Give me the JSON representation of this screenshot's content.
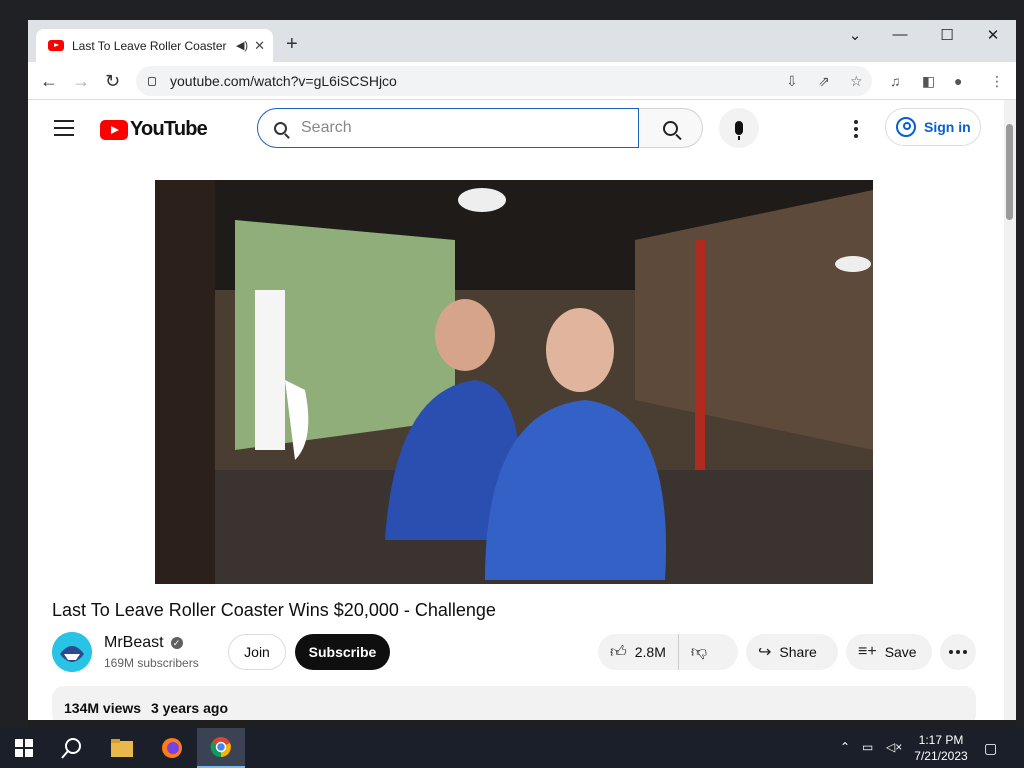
{
  "browser": {
    "tab_title": "Last To Leave Roller Coaster Wins $20,000 - Challenge",
    "tab_short": "Last To Leave Roller Coaster",
    "url": "youtube.com/watch?v=gL6iSCSHjco"
  },
  "youtube": {
    "logo_text": "YouTube",
    "search_placeholder": "Search",
    "signin_label": "Sign in"
  },
  "video": {
    "title": "Last To Leave Roller Coaster Wins $20,000 - Challenge",
    "channel": "MrBeast",
    "subscribers": "169M subscribers",
    "join_label": "Join",
    "subscribe_label": "Subscribe",
    "likes": "2.8M",
    "share_label": "Share",
    "save_label": "Save",
    "views": "134M views",
    "age": "3 years ago"
  },
  "taskbar": {
    "time": "1:17 PM",
    "date": "7/21/2023"
  },
  "colors": {
    "yt_red": "#ff0000",
    "link_blue": "#065fd4"
  }
}
